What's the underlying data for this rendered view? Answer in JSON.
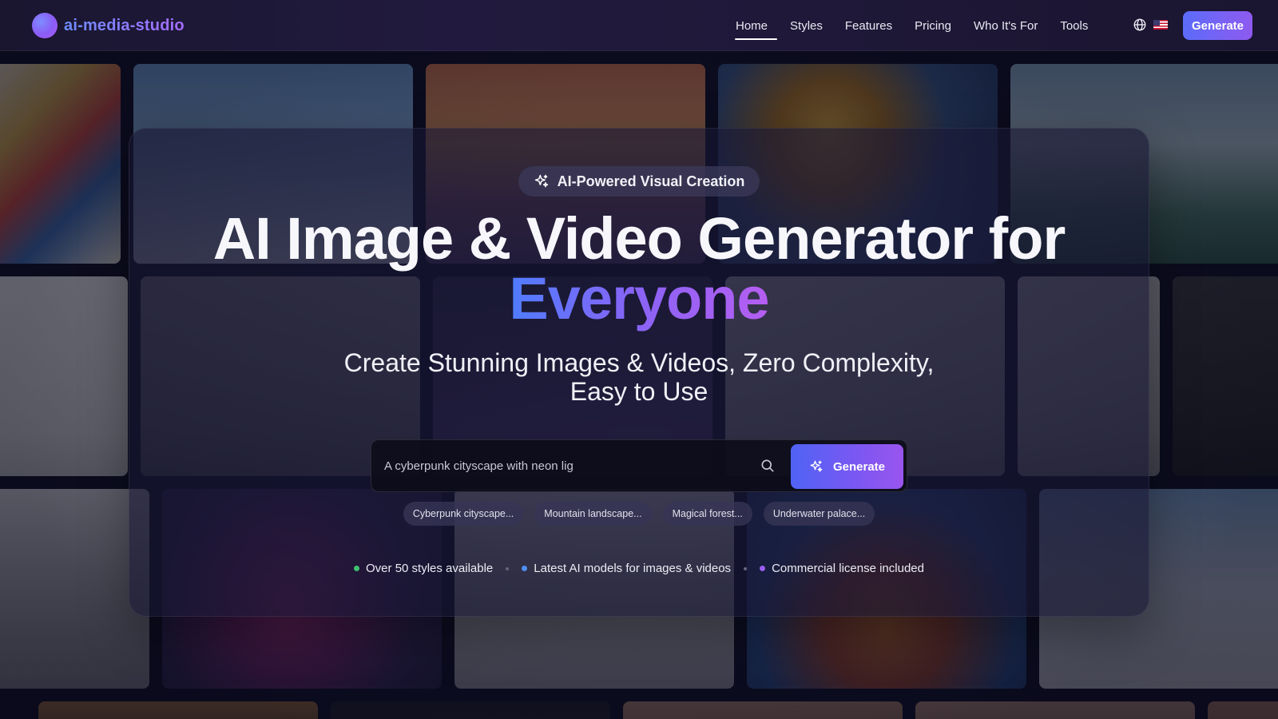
{
  "brand": {
    "name": "ai-media-studio"
  },
  "nav": {
    "links": [
      {
        "label": "Home",
        "active": true
      },
      {
        "label": "Styles"
      },
      {
        "label": "Features"
      },
      {
        "label": "Pricing"
      },
      {
        "label": "Who It's For"
      },
      {
        "label": "Tools"
      }
    ],
    "language_icon": "globe-icon",
    "flag_icon": "us-flag-icon",
    "generate_label": "Generate"
  },
  "hero": {
    "badge": "AI-Powered Visual Creation",
    "headline": "AI Image & Video Generator for",
    "headline_accent": "Everyone",
    "subheading_line1": "Create Stunning Images & Videos, Zero Complexity,",
    "subheading_line2": "Easy to Use"
  },
  "search": {
    "value": "A cyberpunk cityscape with neon lig",
    "icon": "search-icon",
    "button_label": "Generate"
  },
  "suggestions": [
    "Cyberpunk cityscape...",
    "Mountain landscape...",
    "Magical forest...",
    "Underwater palace..."
  ],
  "features": [
    {
      "label": "Over 50 styles available",
      "color": "#3fbf6f"
    },
    {
      "label": "Latest AI models for images & videos",
      "color": "#4f8ff7"
    },
    {
      "label": "Commercial license included",
      "color": "#9b5ef2"
    }
  ],
  "colors": {
    "accent_start": "#4f7cff",
    "accent_end": "#b65ef2",
    "background": "#0b0c1d"
  }
}
